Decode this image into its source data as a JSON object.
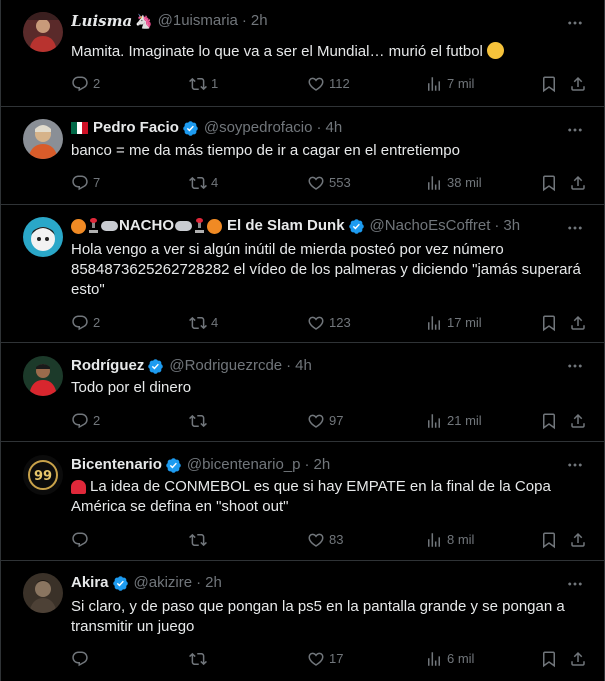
{
  "tweets": [
    {
      "name": "Luisma",
      "handle": "@1uismaria",
      "time": "2h",
      "text": "Mamita. Imaginate lo que va a ser el Mundial… murió el futbol",
      "replies": "2",
      "retweets": "1",
      "likes": "112",
      "views": "7 mil"
    },
    {
      "name": "Pedro Facio",
      "handle": "@soypedrofacio",
      "time": "4h",
      "text": "banco = me da más tiempo de ir a cagar en el entretiempo",
      "replies": "7",
      "retweets": "4",
      "likes": "553",
      "views": "38 mil"
    },
    {
      "name": "NACHO",
      "name2": "El de Slam Dunk",
      "handle": "@NachoEsCoffret",
      "time": "3h",
      "text": "Hola vengo a ver si algún inútil de mierda posteó por vez número 8584873625262728282 el vídeo de los palmeras y diciendo \"jamás superará esto\"",
      "replies": "2",
      "retweets": "4",
      "likes": "123",
      "views": "17 mil"
    },
    {
      "name": "Rodríguez",
      "handle": "@Rodriguezrcde",
      "time": "4h",
      "text": "Todo por el dinero",
      "replies": "2",
      "retweets": "",
      "likes": "97",
      "views": "21 mil"
    },
    {
      "name": "Bicentenario",
      "handle": "@bicentenario_p",
      "time": "2h",
      "text": "La idea de CONMEBOL es que si hay  EMPATE en la final de la Copa América se defina en \"shoot out\"",
      "replies": "",
      "retweets": "",
      "likes": "83",
      "views": "8 mil"
    },
    {
      "name": "Akira",
      "handle": "@akizire",
      "time": "2h",
      "text": "Si claro, y de paso que pongan la ps5 en la pantalla grande y se pongan a transmitir un juego",
      "replies": "",
      "retweets": "",
      "likes": "17",
      "views": "6 mil"
    }
  ],
  "separator": "·",
  "icons": {
    "reply": "reply-icon",
    "retweet": "retweet-icon",
    "like": "heart-icon",
    "views": "views-icon",
    "bookmark": "bookmark-icon",
    "share": "share-icon",
    "more": "more-icon",
    "verified": "verified-badge-icon"
  },
  "colors": {
    "background": "#000000",
    "text": "#e7e9ea",
    "muted": "#71767b",
    "verified": "#1d9bf0",
    "border": "#2f3336"
  }
}
